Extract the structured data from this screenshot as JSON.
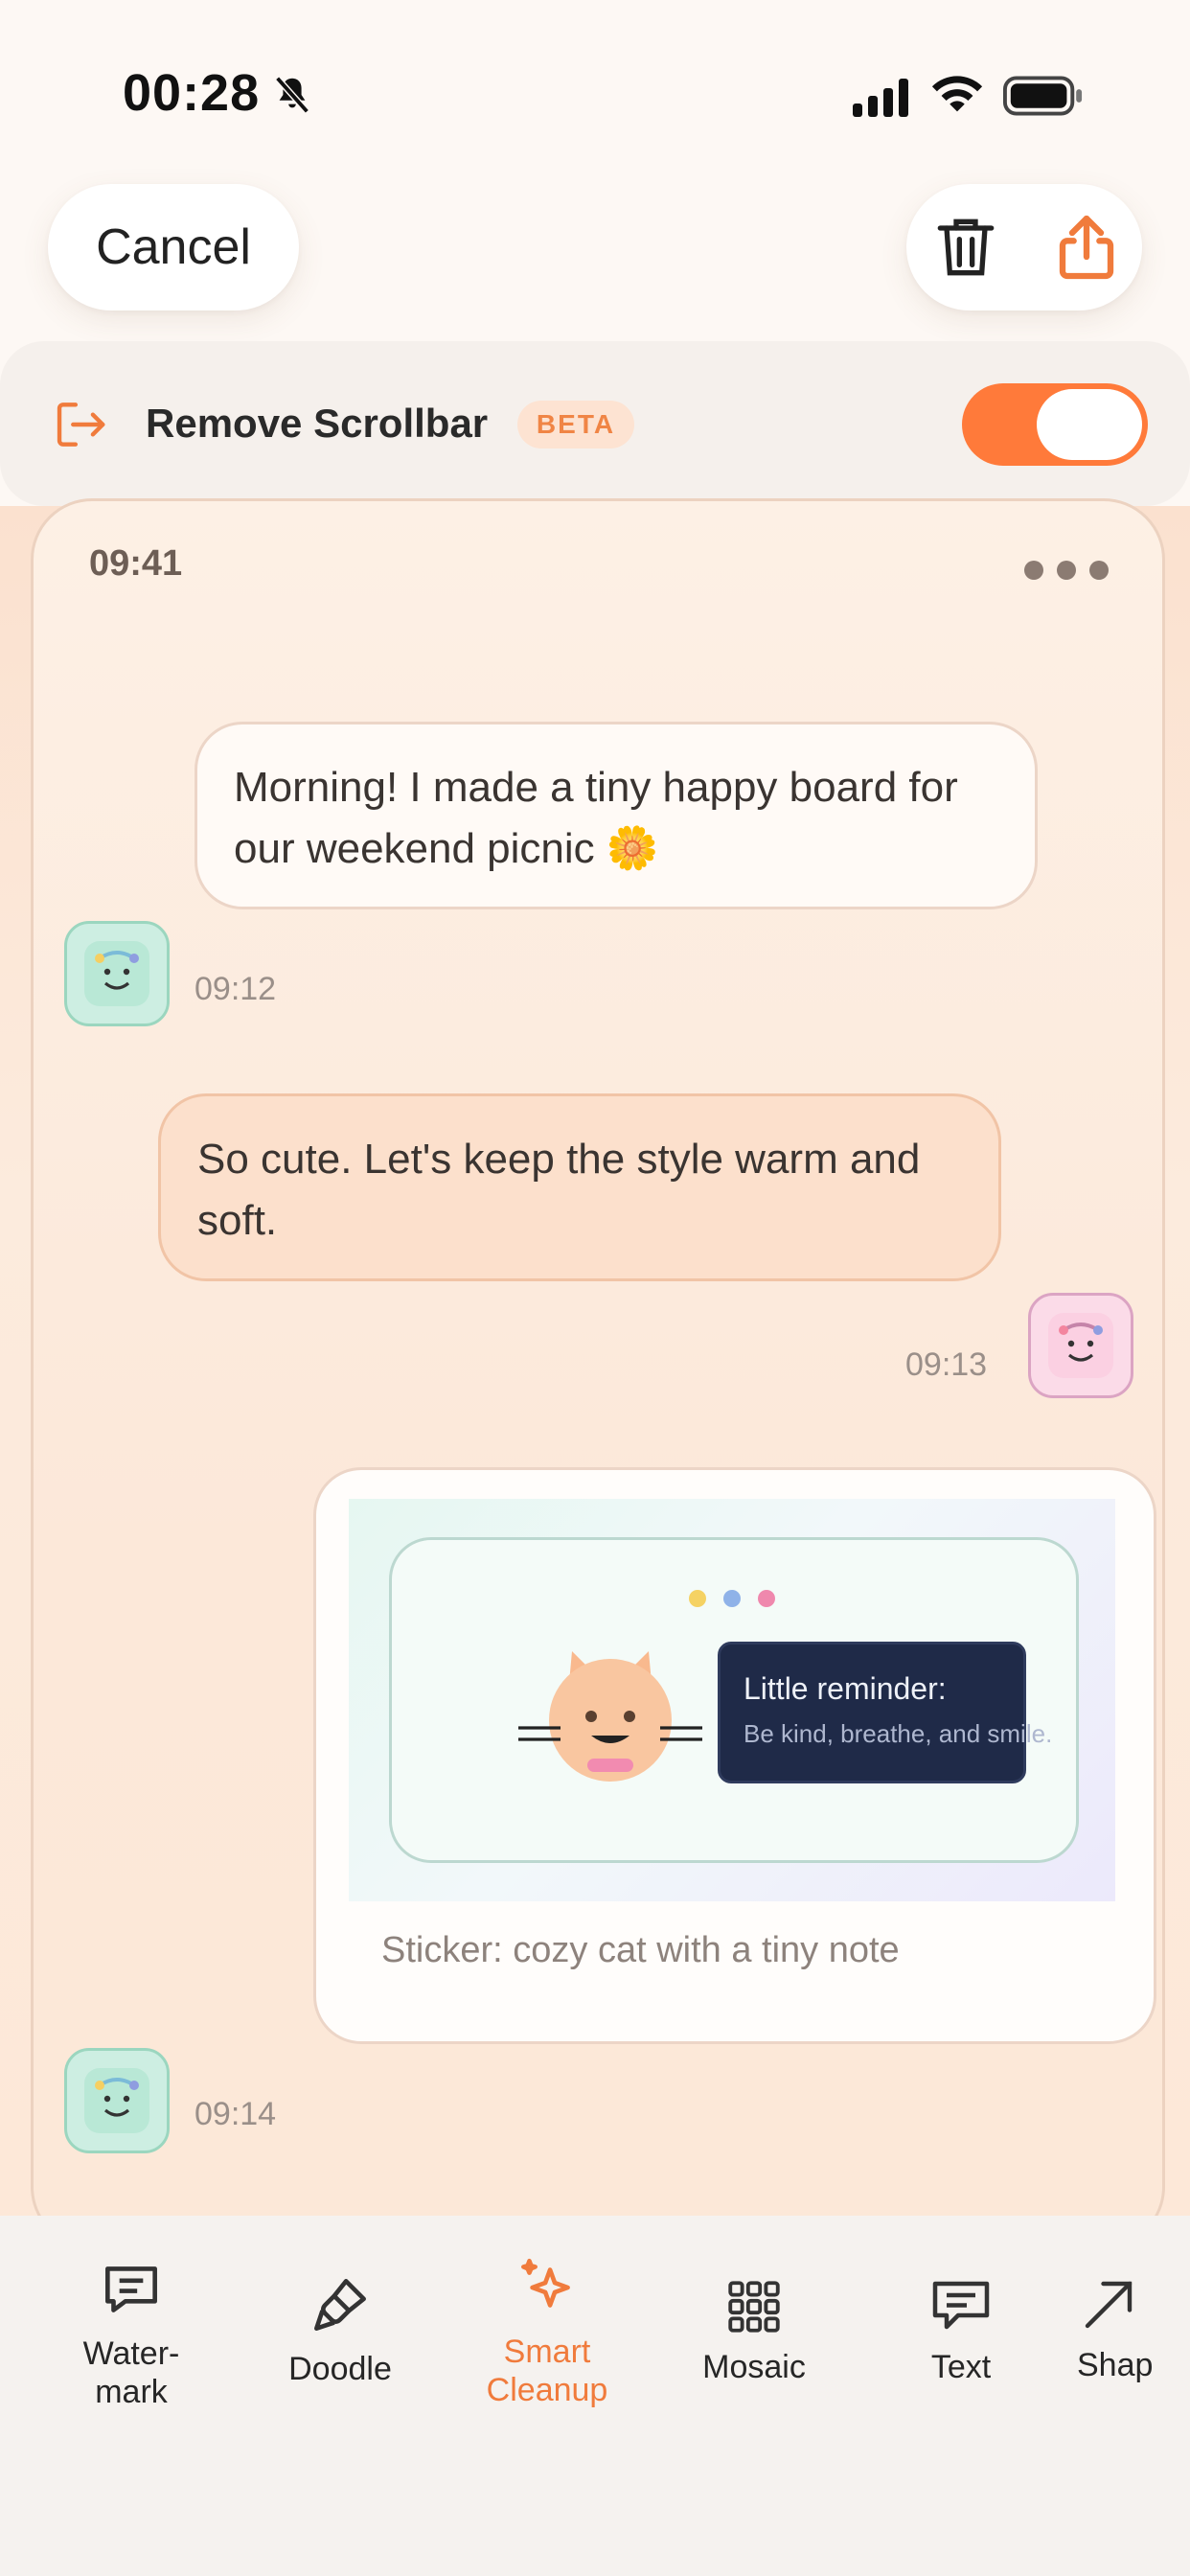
{
  "status_bar": {
    "time": "00:28"
  },
  "header": {
    "cancel_label": "Cancel",
    "icons": [
      "trash-icon",
      "share-icon"
    ],
    "accent_color": "#ff7a3a"
  },
  "remove_scrollbar": {
    "label": "Remove Scrollbar",
    "badge": "BETA",
    "toggle_on": true
  },
  "preview": {
    "time": "09:41",
    "messages": [
      {
        "text": "Morning! I made a tiny happy board for our weekend picnic 🌼",
        "time": "09:12"
      },
      {
        "text": "So cute. Let's keep the style warm and soft.",
        "time": "09:13"
      },
      {
        "sticker_note_title": "Little reminder:",
        "sticker_note_sub": "Be kind, breathe, and smile.",
        "caption": "Sticker: cozy cat with a tiny note",
        "time": "09:14"
      }
    ]
  },
  "toolbar": {
    "items": [
      {
        "label": "Water-\nmark",
        "icon": "watermark-icon"
      },
      {
        "label": "Doodle",
        "icon": "brush-icon"
      },
      {
        "label": "Smart\nCleanup",
        "icon": "sparkle-icon",
        "active": true
      },
      {
        "label": "Mosaic",
        "icon": "grid-icon"
      },
      {
        "label": "Text",
        "icon": "text-bubble-icon"
      },
      {
        "label": "Shap",
        "icon": "arrow-icon"
      }
    ]
  }
}
